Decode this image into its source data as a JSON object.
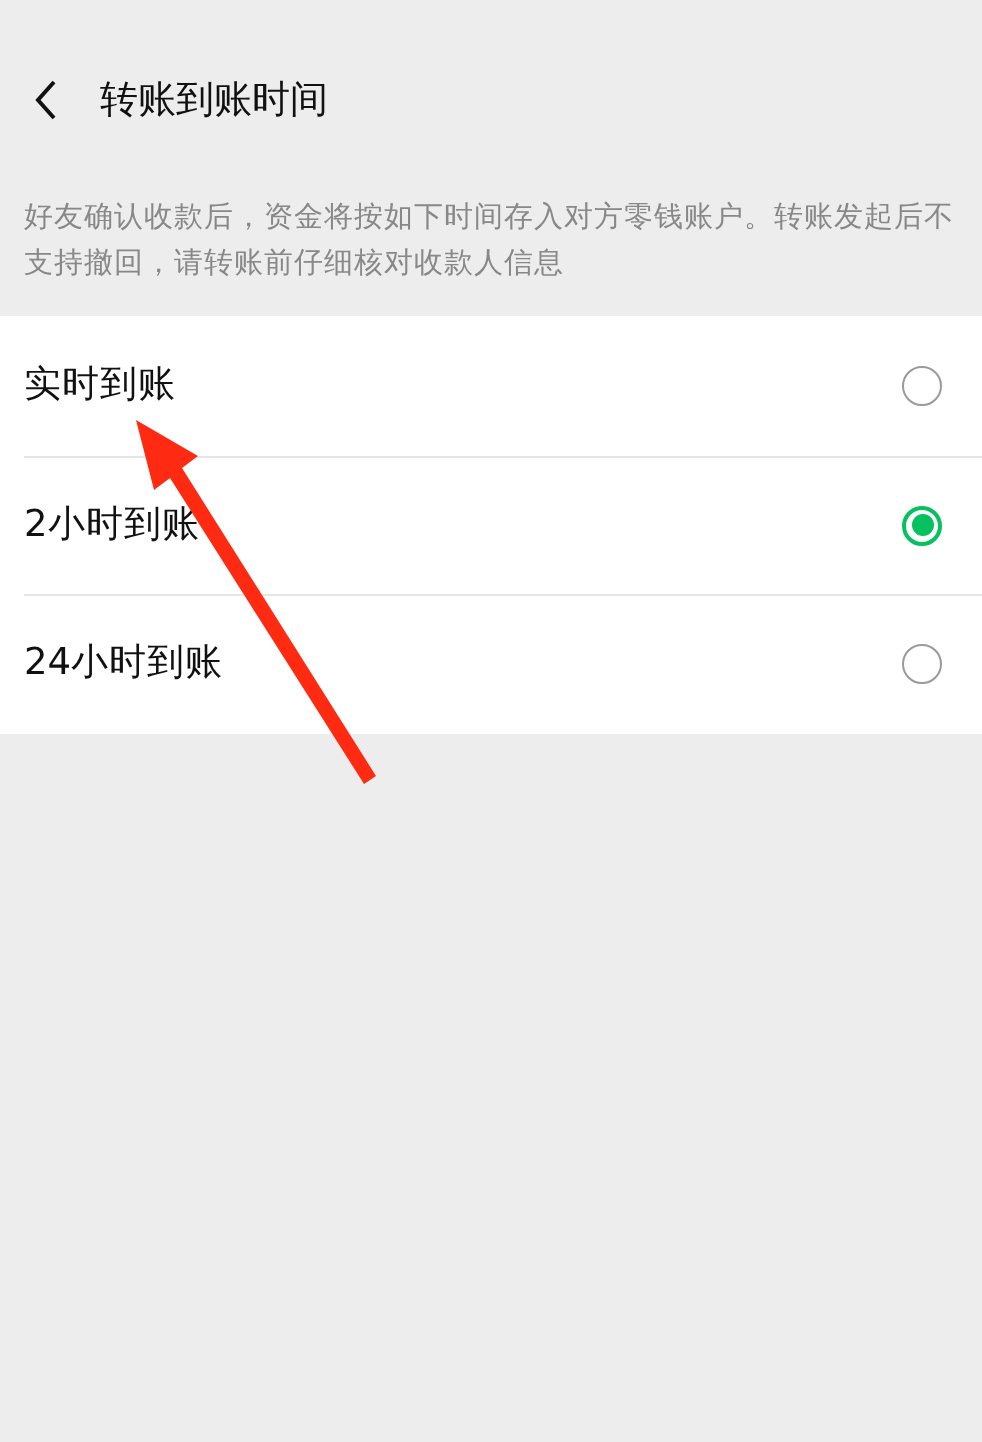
{
  "header": {
    "title": "转账到账时间"
  },
  "description": "好友确认收款后，资金将按如下时间存入对方零钱账户。转账发起后不支持撤回，请转账前仔细核对收款人信息",
  "options": [
    {
      "label": "实时到账",
      "selected": false
    },
    {
      "label": "2小时到账",
      "selected": true
    },
    {
      "label": "24小时到账",
      "selected": false
    }
  ]
}
